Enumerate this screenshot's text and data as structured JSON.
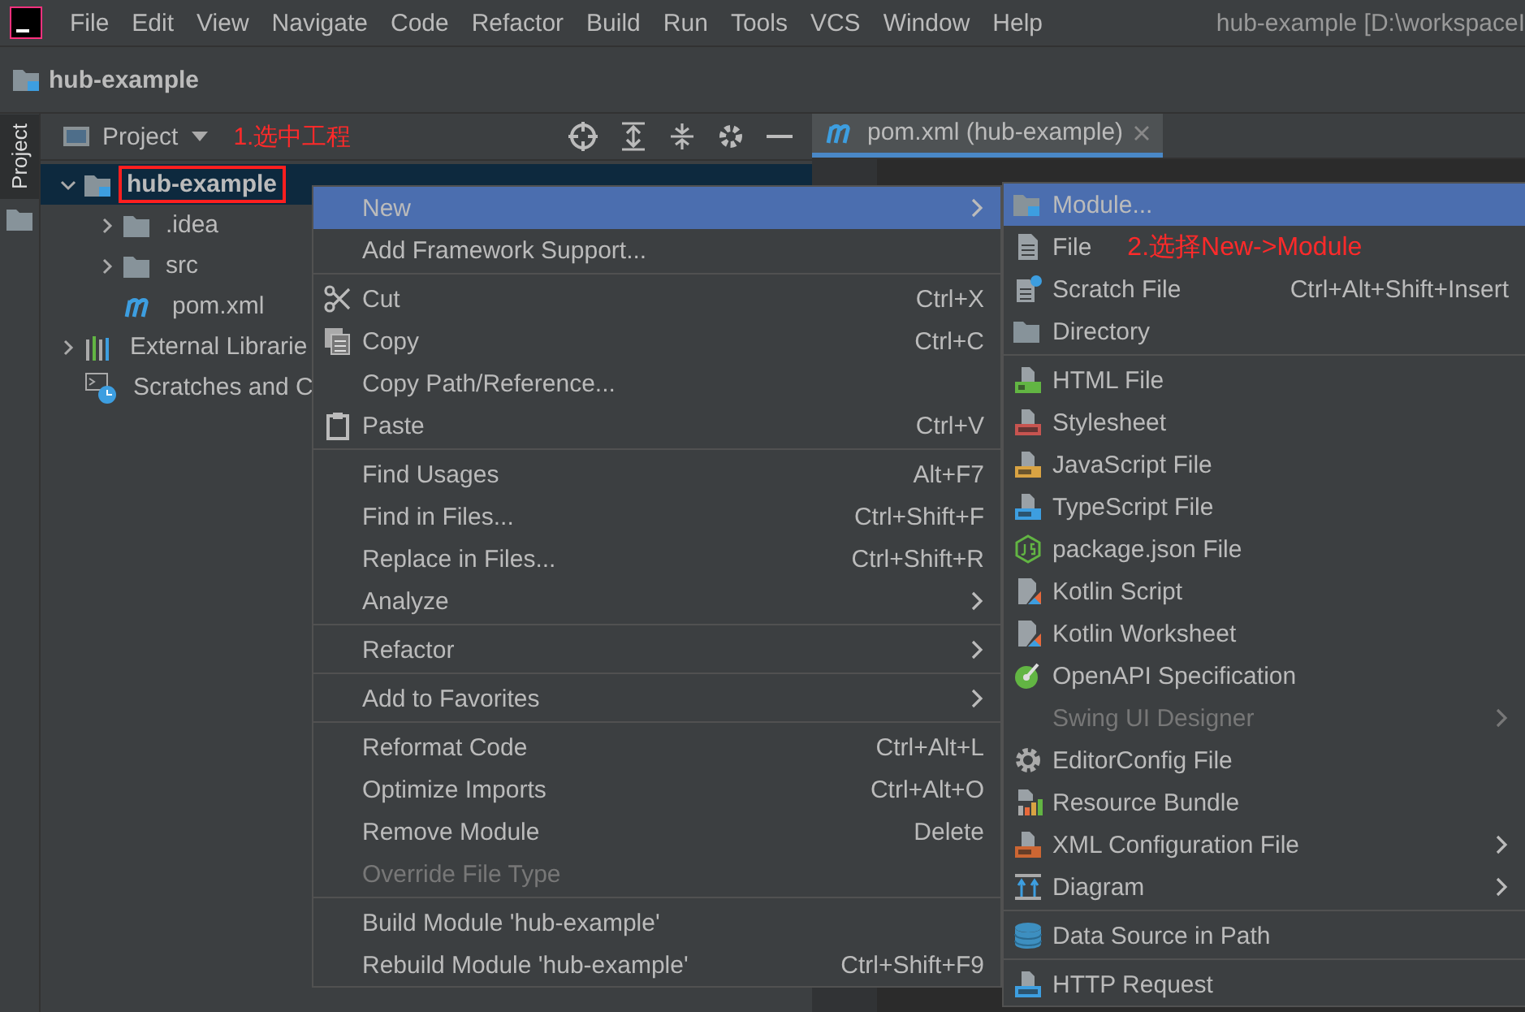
{
  "menu_bar": {
    "menus": [
      "File",
      "Edit",
      "View",
      "Navigate",
      "Code",
      "Refactor",
      "Build",
      "Run",
      "Tools",
      "VCS",
      "Window",
      "Help"
    ],
    "window_title": "hub-example [D:\\workspaceI"
  },
  "nav_bar": {
    "project": "hub-example"
  },
  "side_strip": {
    "tab": "Project"
  },
  "project_panel": {
    "title": "Project",
    "note": "1.选中工程",
    "tree": [
      {
        "label": "hub-example",
        "kind": "module",
        "expanded": true,
        "selected": true,
        "outlined": true,
        "children": [
          {
            "label": ".idea",
            "kind": "folder",
            "expanded": false,
            "selected": false,
            "outlined": false
          },
          {
            "label": "src",
            "kind": "folder",
            "expanded": false,
            "selected": false,
            "outlined": false
          },
          {
            "label": "pom.xml",
            "kind": "maven",
            "selected": false,
            "outlined": false
          }
        ]
      },
      {
        "label": "External Librarie",
        "kind": "libraries",
        "expanded": false,
        "selected": false,
        "outlined": false
      },
      {
        "label": "Scratches and C",
        "kind": "scratches",
        "selected": false,
        "outlined": false
      }
    ]
  },
  "editor": {
    "tabs": [
      {
        "label": "pom.xml (hub-example)",
        "selected": true
      }
    ]
  },
  "context_menu": {
    "items": [
      {
        "kind": "item",
        "label": "New",
        "selected": true,
        "disabled": false,
        "submenu": true
      },
      {
        "kind": "item",
        "label": "Add Framework Support...",
        "selected": false,
        "disabled": false,
        "submenu": false
      },
      {
        "kind": "separator"
      },
      {
        "kind": "cut",
        "label": "Cut",
        "shortcut": "Ctrl+X",
        "selected": false,
        "disabled": false,
        "submenu": false
      },
      {
        "kind": "copy",
        "label": "Copy",
        "shortcut": "Ctrl+C",
        "selected": false,
        "disabled": false,
        "submenu": false
      },
      {
        "kind": "item",
        "label": "Copy Path/Reference...",
        "selected": false,
        "disabled": false,
        "submenu": false
      },
      {
        "kind": "paste",
        "label": "Paste",
        "shortcut": "Ctrl+V",
        "selected": false,
        "disabled": false,
        "submenu": false
      },
      {
        "kind": "separator"
      },
      {
        "kind": "item",
        "label": "Find Usages",
        "shortcut": "Alt+F7",
        "selected": false,
        "disabled": false,
        "submenu": false
      },
      {
        "kind": "item",
        "label": "Find in Files...",
        "shortcut": "Ctrl+Shift+F",
        "selected": false,
        "disabled": false,
        "submenu": false
      },
      {
        "kind": "item",
        "label": "Replace in Files...",
        "shortcut": "Ctrl+Shift+R",
        "selected": false,
        "disabled": false,
        "submenu": false
      },
      {
        "kind": "item",
        "label": "Analyze",
        "selected": false,
        "disabled": false,
        "submenu": true
      },
      {
        "kind": "separator"
      },
      {
        "kind": "item",
        "label": "Refactor",
        "selected": false,
        "disabled": false,
        "submenu": true
      },
      {
        "kind": "separator"
      },
      {
        "kind": "item",
        "label": "Add to Favorites",
        "selected": false,
        "disabled": false,
        "submenu": true
      },
      {
        "kind": "separator"
      },
      {
        "kind": "item",
        "label": "Reformat Code",
        "shortcut": "Ctrl+Alt+L",
        "selected": false,
        "disabled": false,
        "submenu": false
      },
      {
        "kind": "item",
        "label": "Optimize Imports",
        "shortcut": "Ctrl+Alt+O",
        "selected": false,
        "disabled": false,
        "submenu": false
      },
      {
        "kind": "item",
        "label": "Remove Module",
        "shortcut": "Delete",
        "selected": false,
        "disabled": false,
        "submenu": false
      },
      {
        "kind": "item",
        "label": "Override File Type",
        "selected": false,
        "disabled": true,
        "submenu": false
      },
      {
        "kind": "separator"
      },
      {
        "kind": "item",
        "label": "Build Module 'hub-example'",
        "selected": false,
        "disabled": false,
        "submenu": false
      },
      {
        "kind": "item",
        "label": "Rebuild Module 'hub-example'",
        "shortcut": "Ctrl+Shift+F9",
        "selected": false,
        "disabled": false,
        "submenu": false
      }
    ]
  },
  "submenu": {
    "items": [
      {
        "kind": "module",
        "label": "Module...",
        "selected": true,
        "disabled": false,
        "submenu": false
      },
      {
        "kind": "file",
        "label": "File",
        "note": "2.选择New->Module",
        "selected": false,
        "disabled": false,
        "submenu": false
      },
      {
        "kind": "scratch",
        "label": "Scratch File",
        "shortcut": "Ctrl+Alt+Shift+Insert",
        "selected": false,
        "disabled": false,
        "submenu": false
      },
      {
        "kind": "directory",
        "label": "Directory",
        "selected": false,
        "disabled": false,
        "submenu": false
      },
      {
        "kind": "separator"
      },
      {
        "kind": "html",
        "label": "HTML File",
        "selected": false,
        "disabled": false,
        "submenu": false
      },
      {
        "kind": "css",
        "label": "Stylesheet",
        "selected": false,
        "disabled": false,
        "submenu": false
      },
      {
        "kind": "js",
        "label": "JavaScript File",
        "selected": false,
        "disabled": false,
        "submenu": false
      },
      {
        "kind": "ts",
        "label": "TypeScript File",
        "selected": false,
        "disabled": false,
        "submenu": false
      },
      {
        "kind": "npm",
        "label": "package.json File",
        "selected": false,
        "disabled": false,
        "submenu": false
      },
      {
        "kind": "kotlin",
        "label": "Kotlin Script",
        "selected": false,
        "disabled": false,
        "submenu": false
      },
      {
        "kind": "kotlin",
        "label": "Kotlin Worksheet",
        "selected": false,
        "disabled": false,
        "submenu": false
      },
      {
        "kind": "openapi",
        "label": "OpenAPI Specification",
        "selected": false,
        "disabled": false,
        "submenu": false
      },
      {
        "kind": "item",
        "label": "Swing UI Designer",
        "selected": false,
        "disabled": true,
        "submenu": true
      },
      {
        "kind": "editorconfig",
        "label": "EditorConfig File",
        "selected": false,
        "disabled": false,
        "submenu": false
      },
      {
        "kind": "bundle",
        "label": "Resource Bundle",
        "selected": false,
        "disabled": false,
        "submenu": false
      },
      {
        "kind": "xml",
        "label": "XML Configuration File",
        "selected": false,
        "disabled": false,
        "submenu": true
      },
      {
        "kind": "diagram",
        "label": "Diagram",
        "selected": false,
        "disabled": false,
        "submenu": true
      },
      {
        "kind": "separator"
      },
      {
        "kind": "datasource",
        "label": "Data Source in Path",
        "selected": false,
        "disabled": false,
        "submenu": false
      },
      {
        "kind": "separator"
      },
      {
        "kind": "http",
        "label": "HTTP Request",
        "selected": false,
        "disabled": false,
        "submenu": false
      }
    ]
  }
}
